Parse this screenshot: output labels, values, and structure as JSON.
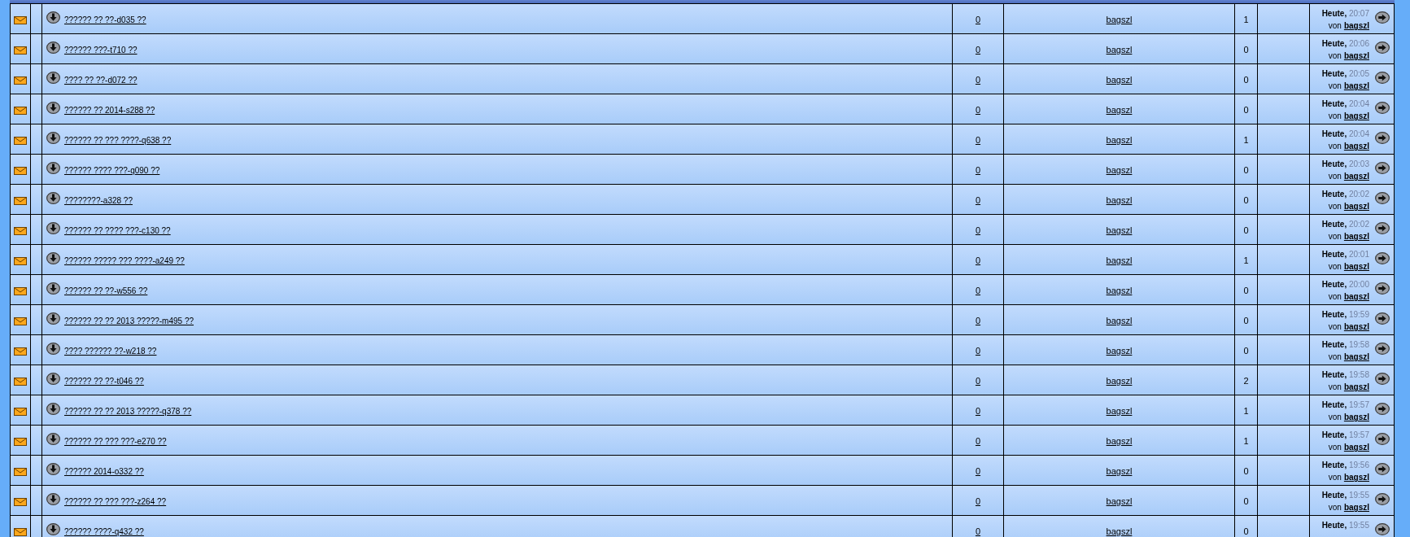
{
  "threads": [
    {
      "title": "?????? ?? ??-d035 ??",
      "replies": "0",
      "author": "bagszl",
      "views": "1",
      "last_post": {
        "date": "**Heute,** 20:07",
        "by_label": "von",
        "by": "bagszl"
      }
    },
    {
      "title": "?????? ???-t710 ??",
      "replies": "0",
      "author": "bagszl",
      "views": "0",
      "last_post": {
        "date": "**Heute,** 20:06",
        "by_label": "von",
        "by": "bagszl"
      }
    },
    {
      "title": "???? ?? ??-d072 ??",
      "replies": "0",
      "author": "bagszl",
      "views": "0",
      "last_post": {
        "date": "**Heute,** 20:05",
        "by_label": "von",
        "by": "bagszl"
      }
    },
    {
      "title": "?????? ?? 2014-s288 ??",
      "replies": "0",
      "author": "bagszl",
      "views": "0",
      "last_post": {
        "date": "**Heute,** 20:04",
        "by_label": "von",
        "by": "bagszl"
      }
    },
    {
      "title": "?????? ?? ??? ????-q638 ??",
      "replies": "0",
      "author": "bagszl",
      "views": "1",
      "last_post": {
        "date": "**Heute,** 20:04",
        "by_label": "von",
        "by": "bagszl"
      }
    },
    {
      "title": "?????? ???? ???-q090 ??",
      "replies": "0",
      "author": "bagszl",
      "views": "0",
      "last_post": {
        "date": "**Heute,** 20:03",
        "by_label": "von",
        "by": "bagszl"
      }
    },
    {
      "title": "????????-a328 ??",
      "replies": "0",
      "author": "bagszl",
      "views": "0",
      "last_post": {
        "date": "**Heute,** 20:02",
        "by_label": "von",
        "by": "bagszl"
      }
    },
    {
      "title": "?????? ?? ???? ???-c130 ??",
      "replies": "0",
      "author": "bagszl",
      "views": "0",
      "last_post": {
        "date": "**Heute,** 20:02",
        "by_label": "von",
        "by": "bagszl"
      }
    },
    {
      "title": "?????? ????? ??? ????-a249 ??",
      "replies": "0",
      "author": "bagszl",
      "views": "1",
      "last_post": {
        "date": "**Heute,** 20:01",
        "by_label": "von",
        "by": "bagszl"
      }
    },
    {
      "title": "?????? ?? ??-w556 ??",
      "replies": "0",
      "author": "bagszl",
      "views": "0",
      "last_post": {
        "date": "**Heute,** 20:00",
        "by_label": "von",
        "by": "bagszl"
      }
    },
    {
      "title": "?????? ?? ?? 2013 ?????-m495 ??",
      "replies": "0",
      "author": "bagszl",
      "views": "0",
      "last_post": {
        "date": "**Heute,** 19:59",
        "by_label": "von",
        "by": "bagszl"
      }
    },
    {
      "title": "???? ?????? ??-w218 ??",
      "replies": "0",
      "author": "bagszl",
      "views": "0",
      "last_post": {
        "date": "**Heute,** 19:58",
        "by_label": "von",
        "by": "bagszl"
      }
    },
    {
      "title": "?????? ?? ??-t046 ??",
      "replies": "0",
      "author": "bagszl",
      "views": "2",
      "last_post": {
        "date": "**Heute,** 19:58",
        "by_label": "von",
        "by": "bagszl"
      }
    },
    {
      "title": "?????? ?? ?? 2013 ?????-q378 ??",
      "replies": "0",
      "author": "bagszl",
      "views": "1",
      "last_post": {
        "date": "**Heute,** 19:57",
        "by_label": "von",
        "by": "bagszl"
      }
    },
    {
      "title": "?????? ?? ??? ???-e270 ??",
      "replies": "0",
      "author": "bagszl",
      "views": "1",
      "last_post": {
        "date": "**Heute,** 19:57",
        "by_label": "von",
        "by": "bagszl"
      }
    },
    {
      "title": "?????? 2014-o332 ??",
      "replies": "0",
      "author": "bagszl",
      "views": "0",
      "last_post": {
        "date": "**Heute,** 19:56",
        "by_label": "von",
        "by": "bagszl"
      }
    },
    {
      "title": "?????? ?? ??? ???-z264 ??",
      "replies": "0",
      "author": "bagszl",
      "views": "0",
      "last_post": {
        "date": "**Heute,** 19:55",
        "by_label": "von",
        "by": "bagszl"
      }
    },
    {
      "title": "?????? ????-q432 ??",
      "replies": "0",
      "author": "bagszl",
      "views": "0",
      "last_post": {
        "date": "**Heute,** 19:55"
      }
    }
  ]
}
